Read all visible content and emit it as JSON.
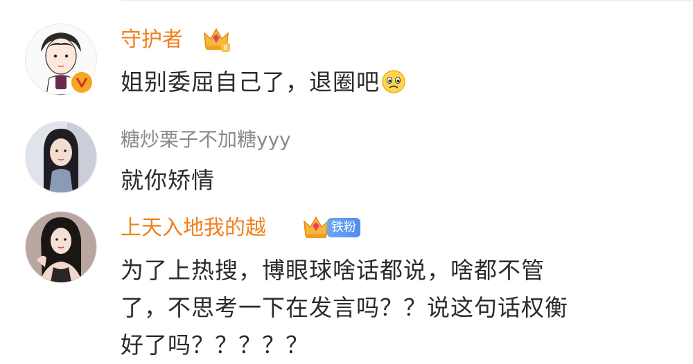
{
  "comments": [
    {
      "username": "守护者",
      "crown_level": "6",
      "text": "姐别委屈自己了，退圈吧",
      "emoji": "sad-face-emoji"
    },
    {
      "username": "糖炒栗子不加糖yyy",
      "text": "就你矫情"
    },
    {
      "username": "上天入地我的越",
      "fan_badge": "铁粉",
      "text_lines": [
        "为了上热搜，博眼球啥话都说，啥都不管",
        "了，不思考一下在发言吗？？说这句话权衡",
        "好了吗？？？？？"
      ]
    }
  ],
  "colors": {
    "vip_name": "#f07f1e",
    "normal_name": "#8a8a8a",
    "text": "#2b2b2b",
    "fan_badge": "#5b97f2",
    "verified": "#f5a623"
  }
}
